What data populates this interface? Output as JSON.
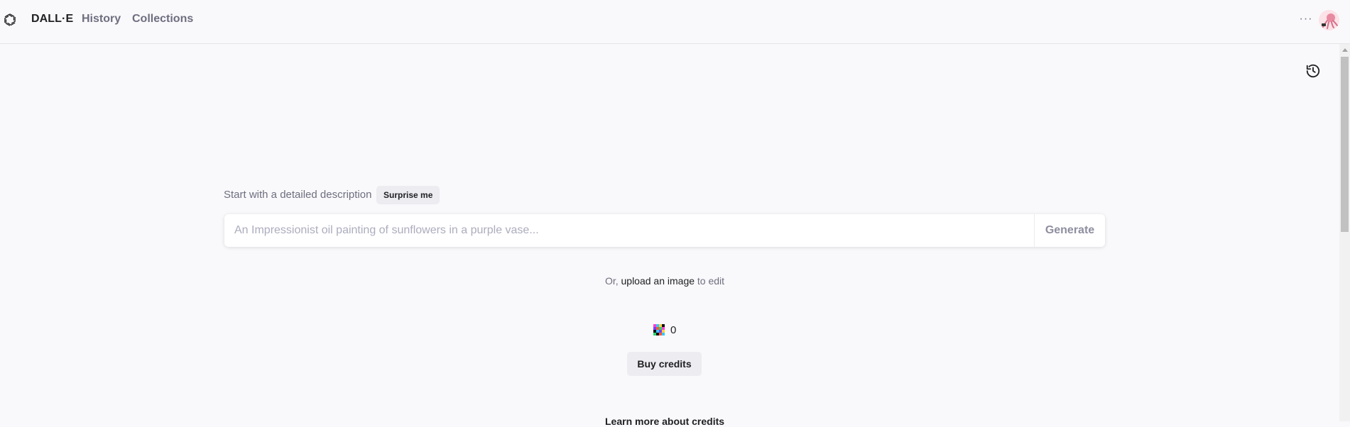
{
  "header": {
    "brand": "DALL·E",
    "nav": [
      {
        "label": "History"
      },
      {
        "label": "Collections"
      }
    ],
    "more_icon": "ellipsis-icon",
    "avatar_icon": "user-avatar"
  },
  "main": {
    "history_icon": "history-icon",
    "prompt_label": "Start with a detailed description",
    "surprise_label": "Surprise me",
    "prompt_placeholder": "An Impressionist oil painting of sunflowers in a purple vase...",
    "prompt_value": "",
    "generate_label": "Generate",
    "upload_prefix": "Or,",
    "upload_link": "upload an image",
    "upload_suffix": "to edit",
    "credits_count": "0",
    "buy_label": "Buy credits",
    "learn_more": "Learn more about credits"
  },
  "colors": {
    "background": "#f9f9fb",
    "text": "#202123",
    "muted": "#6e6e80",
    "button_bg": "#ececf1"
  }
}
